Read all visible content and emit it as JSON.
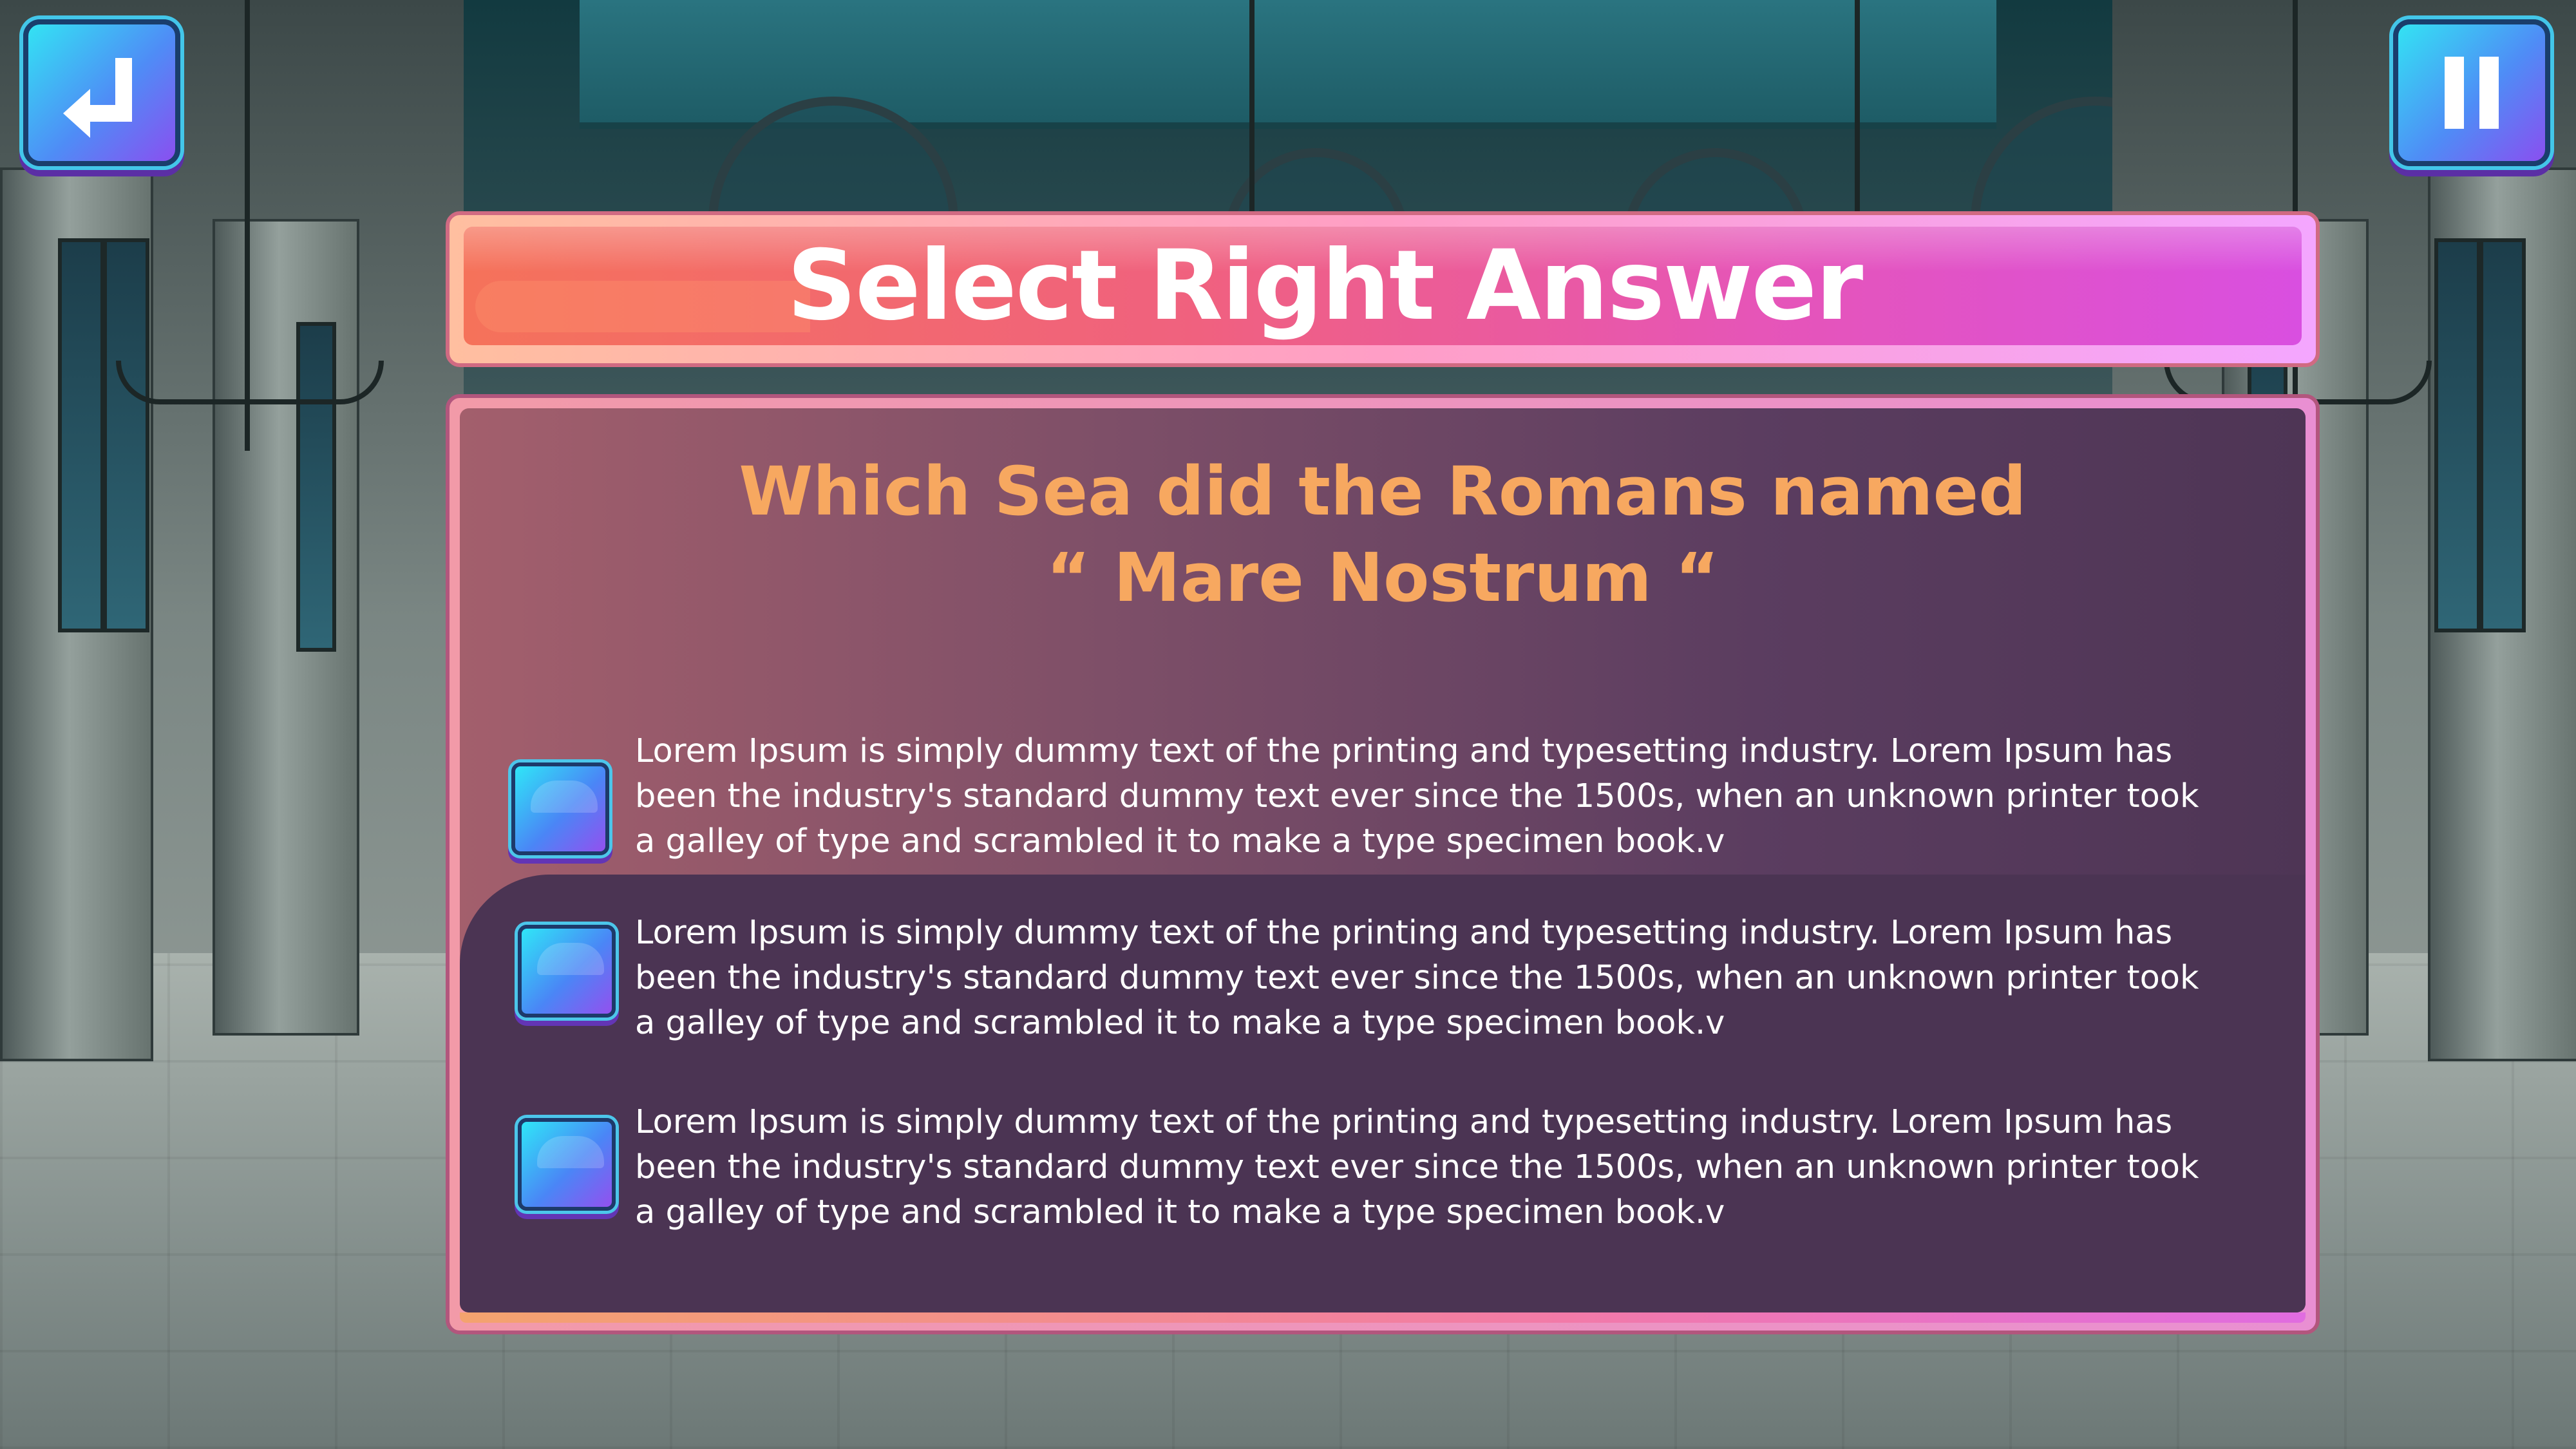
{
  "header": {
    "back_button_icon": "return-arrow-icon",
    "pause_button_icon": "pause-icon"
  },
  "title": {
    "text": "Select Right Answer"
  },
  "question": {
    "line1": "Which Sea did the Romans named",
    "line2": "“ Mare Nostrum “"
  },
  "options": [
    {
      "text": "Lorem Ipsum is simply dummy text of the printing and typesetting industry. Lorem Ipsum has\n been the industry's standard dummy text ever since the 1500s, when an unknown printer took\na galley of type and scrambled it to make a type specimen book.v",
      "selected": false
    },
    {
      "text": "Lorem Ipsum is simply dummy text of the printing and typesetting industry. Lorem Ipsum has\n been the industry's standard dummy text ever since the 1500s, when an unknown printer took\na galley of type and scrambled it to make a type specimen book.v",
      "selected": false
    },
    {
      "text": "Lorem Ipsum is simply dummy text of the printing and typesetting industry. Lorem Ipsum has\n been the industry's standard dummy text ever since the 1500s, when an unknown printer took\na galley of type and scrambled it to make a type specimen book.v",
      "selected": false
    }
  ],
  "colors": {
    "title_gradient_start": "#f5725a",
    "title_gradient_end": "#d94fe0",
    "question_text": "#f7a860",
    "button_cyan": "#33e3f3",
    "button_purple": "#8a4ff0"
  }
}
